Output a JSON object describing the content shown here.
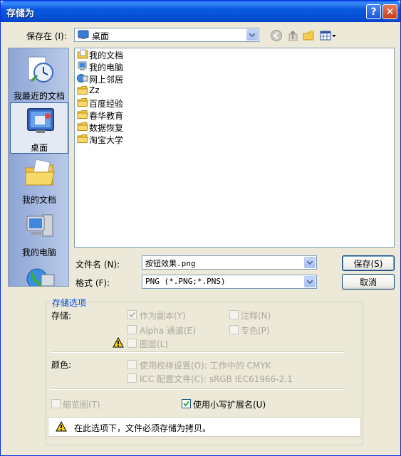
{
  "window": {
    "title": "存储为",
    "help_label": "?",
    "close_label": "✕"
  },
  "location": {
    "label": "保存在 (I):",
    "value": "桌面"
  },
  "places": [
    {
      "label": "我最近的文档",
      "icon": "recent-documents-icon"
    },
    {
      "label": "桌面",
      "icon": "desktop-icon",
      "selected": true
    },
    {
      "label": "我的文档",
      "icon": "my-documents-icon"
    },
    {
      "label": "我的电脑",
      "icon": "my-computer-icon"
    },
    {
      "label": "",
      "icon": "network-places-icon"
    }
  ],
  "files": [
    {
      "name": "我的文档",
      "icon": "my-documents-icon"
    },
    {
      "name": "我的电脑",
      "icon": "my-computer-icon"
    },
    {
      "name": "网上邻居",
      "icon": "network-places-icon"
    },
    {
      "name": "Zz",
      "icon": "folder-icon"
    },
    {
      "name": "百度经验",
      "icon": "folder-icon"
    },
    {
      "name": "春华教育",
      "icon": "folder-icon"
    },
    {
      "name": "数据恢复",
      "icon": "folder-icon"
    },
    {
      "name": "淘宝大学",
      "icon": "folder-icon"
    }
  ],
  "filename": {
    "label": "文件名 (N):",
    "value": "按钮效果.png"
  },
  "format": {
    "label": "格式 (F):",
    "value": "PNG (*.PNG;*.PNS)"
  },
  "buttons": {
    "save": "保存(S)",
    "cancel": "取消"
  },
  "options": {
    "title": "存储选项",
    "storage_label": "存储:",
    "as_copy": "作为副本(Y)",
    "annotations": "注释(N)",
    "alpha": "Alpha 通道(E)",
    "spot": "专色(P)",
    "layers": "图层(L)",
    "color_label": "颜色:",
    "proof": "使用校样设置(O):  工作中的 CMYK",
    "icc": "ICC 配置文件(C):  sRGB IEC61966-2.1",
    "thumbnail": "缩览图(T)",
    "lowercase_ext": "使用小写扩展名(U)",
    "warning": "在此选项下，文件必须存储为拷贝。"
  },
  "colors": {
    "title_bar": "#0858e0",
    "group_title": "#0046d5",
    "dialog_bg": "#ece9d8"
  }
}
